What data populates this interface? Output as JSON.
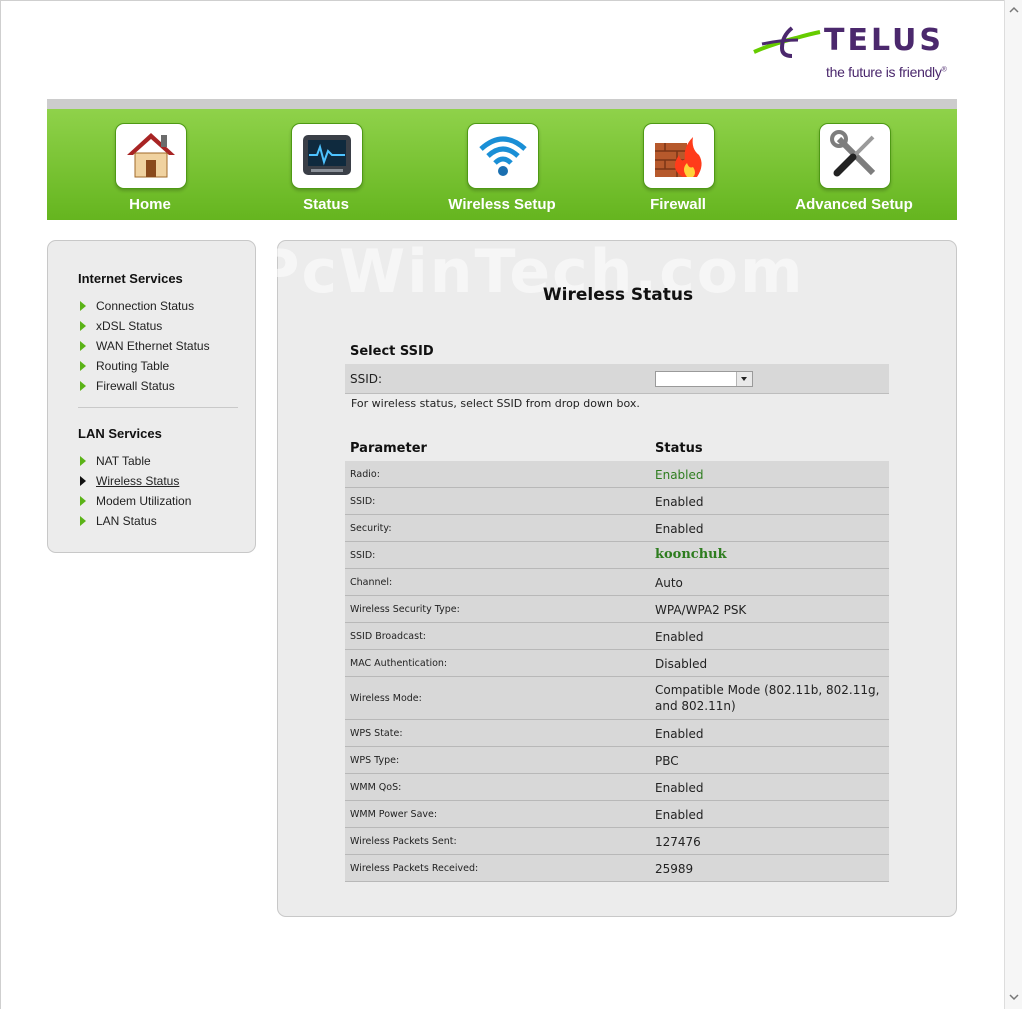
{
  "brand": {
    "name": "TELUS",
    "tagline": "the future is friendly",
    "trademark": "®"
  },
  "nav": {
    "items": [
      {
        "label": "Home",
        "icon": "house-icon"
      },
      {
        "label": "Status",
        "icon": "monitor-icon"
      },
      {
        "label": "Wireless Setup",
        "icon": "wifi-icon"
      },
      {
        "label": "Firewall",
        "icon": "firewall-icon"
      },
      {
        "label": "Advanced Setup",
        "icon": "tools-icon"
      }
    ]
  },
  "sidebar": {
    "internet_services": {
      "title": "Internet Services",
      "items": [
        "Connection Status",
        "xDSL Status",
        "WAN Ethernet Status",
        "Routing Table",
        "Firewall Status"
      ]
    },
    "lan_services": {
      "title": "LAN Services",
      "items": [
        "NAT Table",
        "Wireless Status",
        "Modem Utilization",
        "LAN Status"
      ],
      "active_item": "Wireless Status"
    }
  },
  "watermark": "PcWinTech.com",
  "main": {
    "title": "Wireless Status",
    "select_ssid": {
      "title": "Select SSID",
      "label": "SSID:",
      "selected_value": "",
      "hint": "For wireless status, select SSID from drop down box."
    },
    "table": {
      "headers": [
        "Parameter",
        "Status"
      ],
      "rows": [
        {
          "parameter": "Radio:",
          "status": "Enabled"
        },
        {
          "parameter": "SSID:",
          "status": "Enabled"
        },
        {
          "parameter": "Security:",
          "status": "Enabled"
        },
        {
          "parameter": "SSID:",
          "status": "koonchuk"
        },
        {
          "parameter": "Channel:",
          "status": "Auto"
        },
        {
          "parameter": "Wireless Security Type:",
          "status": "WPA/WPA2 PSK"
        },
        {
          "parameter": "SSID Broadcast:",
          "status": "Enabled"
        },
        {
          "parameter": "MAC Authentication:",
          "status": "Disabled"
        },
        {
          "parameter": "Wireless Mode:",
          "status": "Compatible Mode (802.11b, 802.11g, and 802.11n)"
        },
        {
          "parameter": "WPS State:",
          "status": "Enabled"
        },
        {
          "parameter": "WPS Type:",
          "status": "PBC"
        },
        {
          "parameter": "WMM QoS:",
          "status": "Enabled"
        },
        {
          "parameter": "WMM Power Save:",
          "status": "Enabled"
        },
        {
          "parameter": "Wireless Packets Sent:",
          "status": "127476"
        },
        {
          "parameter": "Wireless Packets Received:",
          "status": "25989"
        }
      ]
    }
  },
  "colors": {
    "brand_purple": "#4b286d",
    "nav_green": "#65b51f",
    "status_green": "#2e7d1f"
  }
}
